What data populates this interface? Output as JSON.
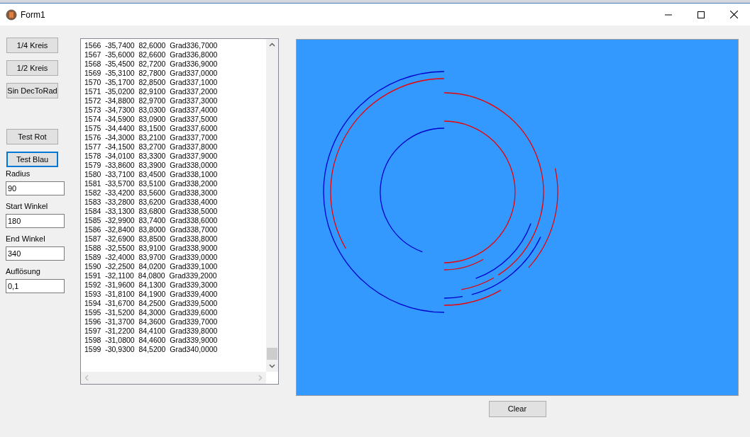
{
  "window": {
    "title": "Form1"
  },
  "buttons": [
    {
      "label": "1/4 Kreis",
      "focused": false
    },
    {
      "label": "1/2 Kreis",
      "focused": false
    },
    {
      "label": "Sin DecToRad",
      "focused": false
    },
    {
      "label": "Test Rot",
      "focused": false
    },
    {
      "label": "Test Blau",
      "focused": true
    }
  ],
  "fields": [
    {
      "label": "Radius",
      "value": "90"
    },
    {
      "label": "Start Winkel",
      "value": "180"
    },
    {
      "label": "End Winkel",
      "value": "340"
    },
    {
      "label": "Auflösung",
      "value": "0,1"
    }
  ],
  "list": {
    "items": [
      "1566  -35,7400  82,6000  Grad336,7000",
      "1567  -35,6000  82,6600  Grad336,8000",
      "1568  -35,4500  82,7200  Grad336,9000",
      "1569  -35,3100  82,7800  Grad337,0000",
      "1570  -35,1700  82,8500  Grad337,1000",
      "1571  -35,0200  82,9100  Grad337,2000",
      "1572  -34,8800  82,9700  Grad337,3000",
      "1573  -34,7300  83,0300  Grad337,4000",
      "1574  -34,5900  83,0900  Grad337,5000",
      "1575  -34,4400  83,1500  Grad337,6000",
      "1576  -34,3000  83,2100  Grad337,7000",
      "1577  -34,1500  83,2700  Grad337,8000",
      "1578  -34,0100  83,3300  Grad337,9000",
      "1579  -33,8600  83,3900  Grad338,0000",
      "1580  -33,7100  83,4500  Grad338,1000",
      "1581  -33,5700  83,5100  Grad338,2000",
      "1582  -33,4200  83,5600  Grad338,3000",
      "1583  -33,2800  83,6200  Grad338,4000",
      "1584  -33,1300  83,6800  Grad338,5000",
      "1585  -32,9900  83,7400  Grad338,6000",
      "1586  -32,8400  83,8000  Grad338,7000",
      "1587  -32,6900  83,8500  Grad338,8000",
      "1588  -32,5500  83,9100  Grad338,9000",
      "1589  -32,4000  83,9700  Grad339,0000",
      "1590  -32,2500  84,0200  Grad339,1000",
      "1591  -32,1100  84,0800  Grad339,2000",
      "1592  -31,9600  84,1300  Grad339,3000",
      "1593  -31,8100  84,1900  Grad339,4000",
      "1594  -31,6700  84,2500  Grad339,5000",
      "1595  -31,5200  84,3000  Grad339,6000",
      "1596  -31,3700  84,3600  Grad339,7000",
      "1597  -31,2200  84,4100  Grad339,8000",
      "1598  -31,0800  84,4600  Grad339,9000",
      "1599  -30,9300  84,5200  Grad340,0000"
    ]
  },
  "clear_button": {
    "label": "Clear"
  }
}
